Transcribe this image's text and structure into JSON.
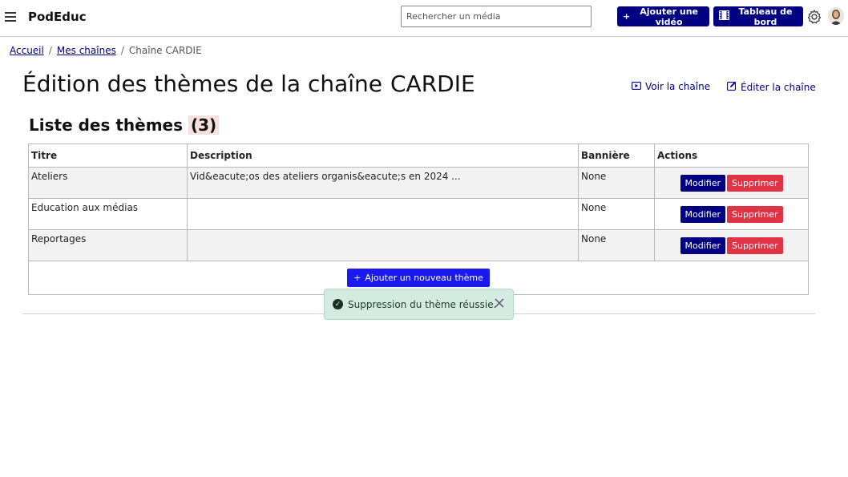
{
  "header": {
    "brand": "PodEduc",
    "search_placeholder": "Rechercher un média",
    "add_video_label": "Ajouter une vidéo",
    "dashboard_label": "Tableau de bord"
  },
  "breadcrumb": {
    "home": "Accueil",
    "my_channels": "Mes chaînes",
    "current": "Chaîne CARDIE"
  },
  "page": {
    "title": "Édition des thèmes de la chaîne",
    "channel_name": "CARDIE",
    "view_channel": "Voir la chaîne",
    "edit_channel": "Éditer la chaîne"
  },
  "section": {
    "title": "Liste des thèmes",
    "count": "(3)"
  },
  "table": {
    "headers": {
      "title": "Titre",
      "description": "Description",
      "banner": "Bannière",
      "actions": "Actions"
    },
    "rows": [
      {
        "title": "Ateliers",
        "description": "Vid&eacute;os des ateliers organis&eacute;s en 2024 ...",
        "banner": "None"
      },
      {
        "title": "Education aux médias",
        "description": "",
        "banner": "None"
      },
      {
        "title": "Reportages",
        "description": "",
        "banner": "None"
      }
    ],
    "modify_label": "Modifier",
    "delete_label": "Supprimer",
    "add_theme_label": "Ajouter un nouveau thème"
  },
  "toast": {
    "message": "Suppression du thème réussie."
  },
  "colors": {
    "primary": "#000080",
    "danger": "#e03346",
    "accent": "#1a1af0",
    "success_bg": "#d4ebe0"
  }
}
